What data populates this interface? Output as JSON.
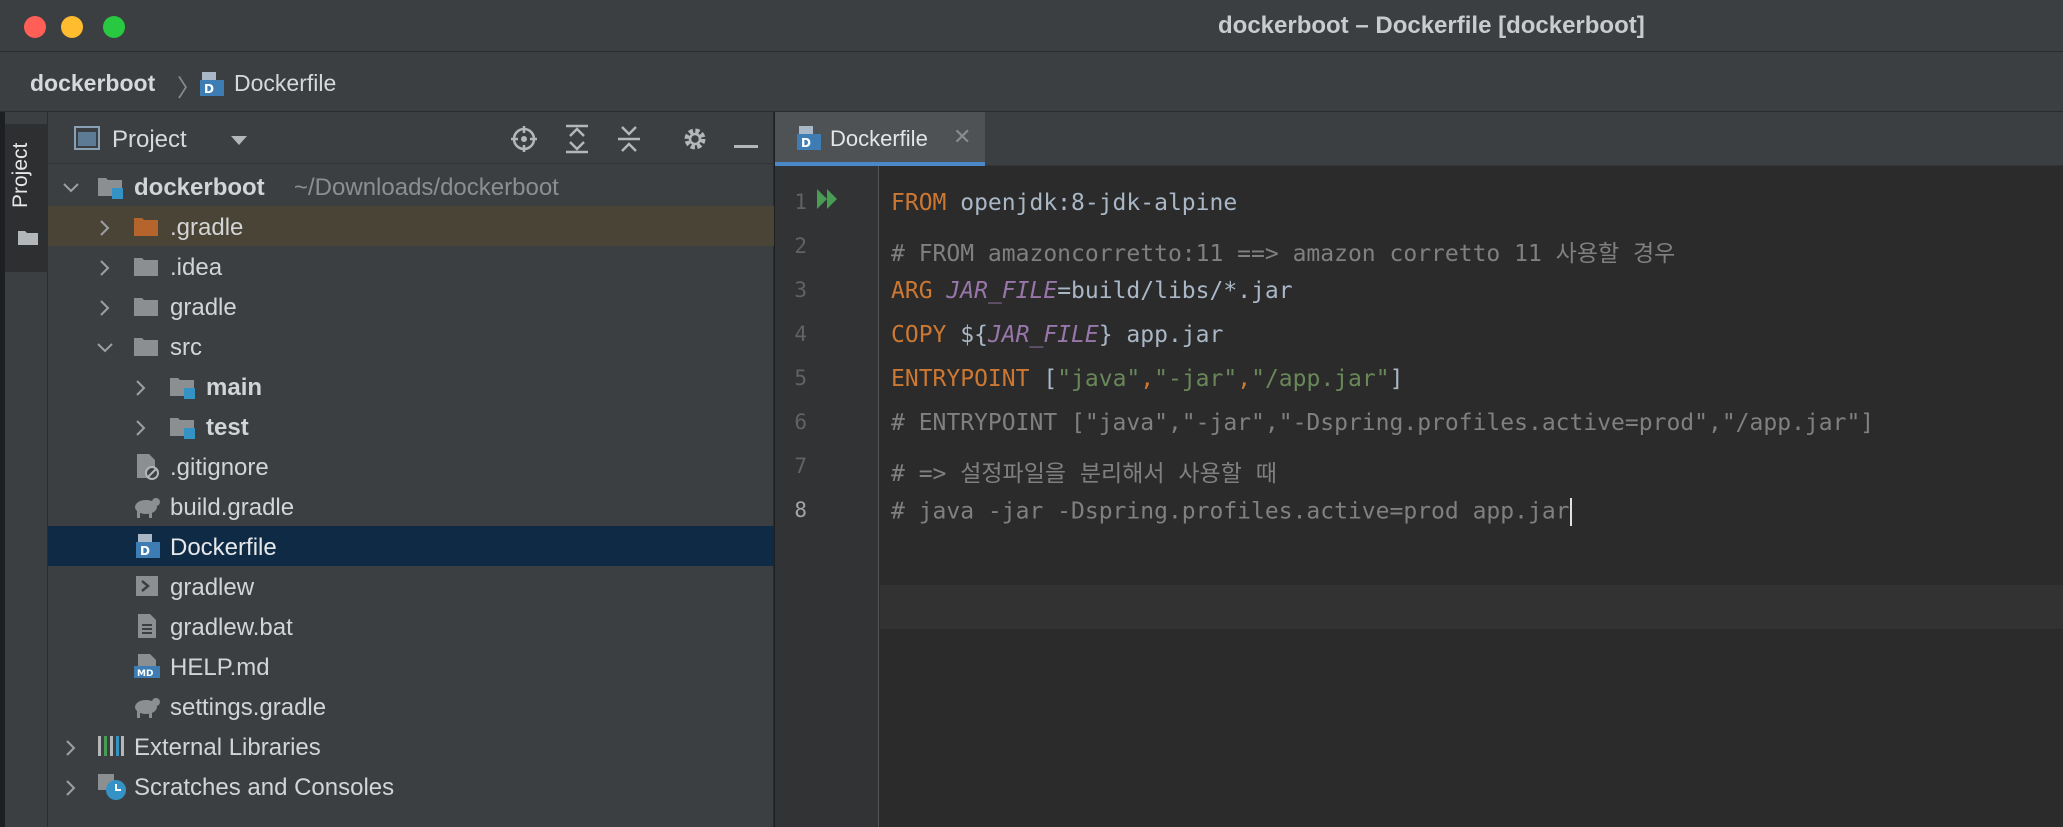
{
  "window": {
    "title": "dockerboot – Dockerfile [dockerboot]"
  },
  "breadcrumb": {
    "project": "dockerboot",
    "file": "Dockerfile"
  },
  "toolstrip": {
    "project_tab": "Project"
  },
  "project_panel": {
    "title": "Project",
    "tree": [
      {
        "label": "dockerboot",
        "path": "~/Downloads/dockerboot"
      },
      {
        "label": ".gradle"
      },
      {
        "label": ".idea"
      },
      {
        "label": "gradle"
      },
      {
        "label": "src"
      },
      {
        "label": "main"
      },
      {
        "label": "test"
      },
      {
        "label": ".gitignore"
      },
      {
        "label": "build.gradle"
      },
      {
        "label": "Dockerfile"
      },
      {
        "label": "gradlew"
      },
      {
        "label": "gradlew.bat"
      },
      {
        "label": "HELP.md"
      },
      {
        "label": "settings.gradle"
      },
      {
        "label": "External Libraries"
      },
      {
        "label": "Scratches and Consoles"
      }
    ]
  },
  "editor": {
    "tab": "Dockerfile",
    "line_numbers": [
      "1",
      "2",
      "3",
      "4",
      "5",
      "6",
      "7",
      "8"
    ],
    "current_line": 8,
    "lines": [
      {
        "kw": "FROM",
        "rest": " openjdk:8-jdk-alpine"
      },
      {
        "comment": "# FROM amazoncorretto:11 ==> amazon corretto 11 사용할 경우"
      },
      {
        "kw": "ARG",
        "sp": " ",
        "var": "JAR_FILE",
        "rest": "=build/libs/*.jar"
      },
      {
        "kw": "COPY",
        "pre": " ${",
        "var": "JAR_FILE",
        "rest": "} app.jar"
      },
      {
        "kw": "ENTRYPOINT",
        "pre": " [",
        "s1": "\"java\"",
        "c1": ",",
        "s2": "\"-jar\"",
        "c2": ",",
        "s3": "\"/app.jar\"",
        "post": "]"
      },
      {
        "comment": "# ENTRYPOINT [\"java\",\"-jar\",\"-Dspring.profiles.active=prod\",\"/app.jar\"]"
      },
      {
        "comment": "# => 설정파일을 분리해서 사용할 때"
      },
      {
        "comment": "# java -jar -Dspring.profiles.active=prod app.jar"
      }
    ]
  },
  "colors": {
    "keyword": "#cc7832",
    "variable": "#9876aa",
    "string": "#6a8759",
    "comment": "#808080",
    "selection": "#0f2a45",
    "accent": "#4a88c7"
  }
}
